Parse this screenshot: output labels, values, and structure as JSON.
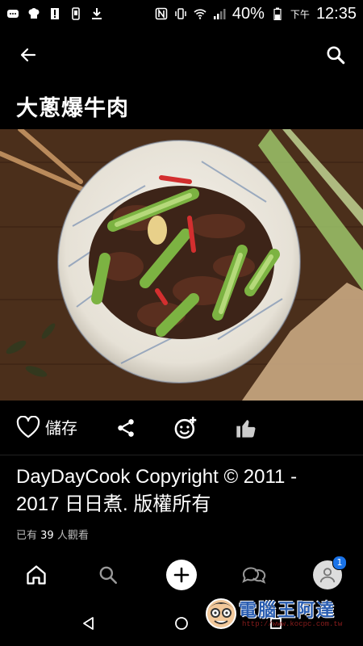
{
  "status_bar": {
    "battery_pct": "40%",
    "time_prefix": "下午",
    "time": "12:35"
  },
  "header": {
    "title": "大蔥爆牛肉"
  },
  "actions": {
    "save_label": "儲存"
  },
  "credit": {
    "line1": "DayDayCook Copyright © 2011 -",
    "line2": "2017 日日煮. 版權所有"
  },
  "views": {
    "prefix": "已有",
    "count": "39",
    "suffix": "人觀看"
  },
  "bottom_nav": {
    "profile_badge": "1"
  },
  "watermark": {
    "title": "電腦王阿達",
    "url": "http://www.kocpc.com.tw"
  },
  "colors": {
    "background": "#000000",
    "badge": "#1a73e8",
    "watermark_blue": "#2a5db0"
  }
}
